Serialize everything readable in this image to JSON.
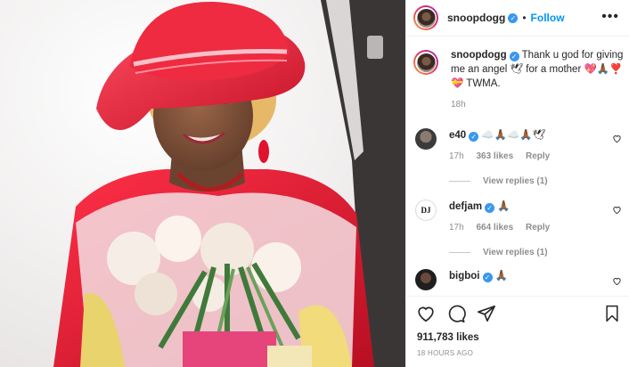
{
  "post": {
    "author": "snoopdogg",
    "follow_label": "Follow",
    "separator": "•",
    "more_label": "•••",
    "verified_mark": "✓"
  },
  "caption": {
    "username": "snoopdogg",
    "text": "Thank u god for giving me an angel 🕊 for a mother 💖🙏🏾❣️💝 TWMA.",
    "time": "18h"
  },
  "comments": [
    {
      "username": "e40",
      "text": "☁️🙏🏾☁️🙏🏾🕊",
      "time": "17h",
      "likes": "363 likes",
      "reply_label": "Reply",
      "view_replies": "View replies (1)"
    },
    {
      "username": "defjam",
      "text": "🙏🏾",
      "time": "17h",
      "likes": "664 likes",
      "reply_label": "Reply",
      "view_replies": "View replies (1)"
    },
    {
      "username": "bigboi",
      "text": "🙏🏾"
    }
  ],
  "footer": {
    "likes": "911,783 likes",
    "time_ago": "18 HOURS AGO"
  },
  "icons": {
    "like": "heart-icon",
    "comment": "comment-icon",
    "share": "share-icon",
    "save": "bookmark-icon",
    "more": "more-icon"
  },
  "colors": {
    "accent": "#0095f6",
    "verified": "#3897f0",
    "text": "#262626",
    "muted": "#8e8e8e",
    "hat": "#e8283d"
  }
}
